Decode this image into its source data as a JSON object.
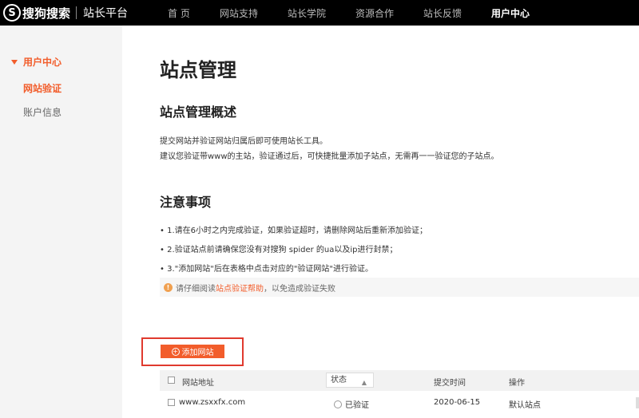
{
  "brand": {
    "logo_mark": "S",
    "name": "搜狗搜索",
    "subtitle": "站长平台"
  },
  "nav": {
    "items": [
      "首 页",
      "网站支持",
      "站长学院",
      "资源合作",
      "站长反馈",
      "用户中心"
    ],
    "active": "用户中心"
  },
  "sidebar": {
    "heading": "用户中心",
    "items": [
      "网站验证",
      "账户信息"
    ],
    "active": "网站验证"
  },
  "main": {
    "title": "站点管理",
    "overview_heading": "站点管理概述",
    "overview_lines": [
      "提交网站并验证网站归属后即可使用站长工具。",
      "建议您验证带www的主站，验证通过后，可快捷批量添加子站点，无需再一一验证您的子站点。"
    ],
    "notes_heading": "注意事项",
    "notes": [
      "• 1.请在6小时之内完成验证，如果验证超时，请删除网站后重新添加验证；",
      "• 2.验证站点前请确保您没有对搜狗 spider 的ua以及ip进行封禁；",
      "• 3.\"添加网站\"后在表格中点击对应的\"验证网站\"进行验证。"
    ],
    "tip": {
      "prefix": "请仔细阅读",
      "link": "站点验证帮助",
      "suffix": "，以免造成验证失败"
    },
    "add_button": "添加网站",
    "table": {
      "headers": {
        "site": "网站地址",
        "status": "状态",
        "time": "提交时间",
        "action": "操作"
      },
      "rows": [
        {
          "site": "www.zsxxfx.com",
          "status": "已验证",
          "time": "2020-06-15",
          "action": "默认站点"
        }
      ]
    }
  },
  "colors": {
    "accent": "#f25d2b",
    "highlight_border": "#e03a2e",
    "topbar": "#000000"
  }
}
